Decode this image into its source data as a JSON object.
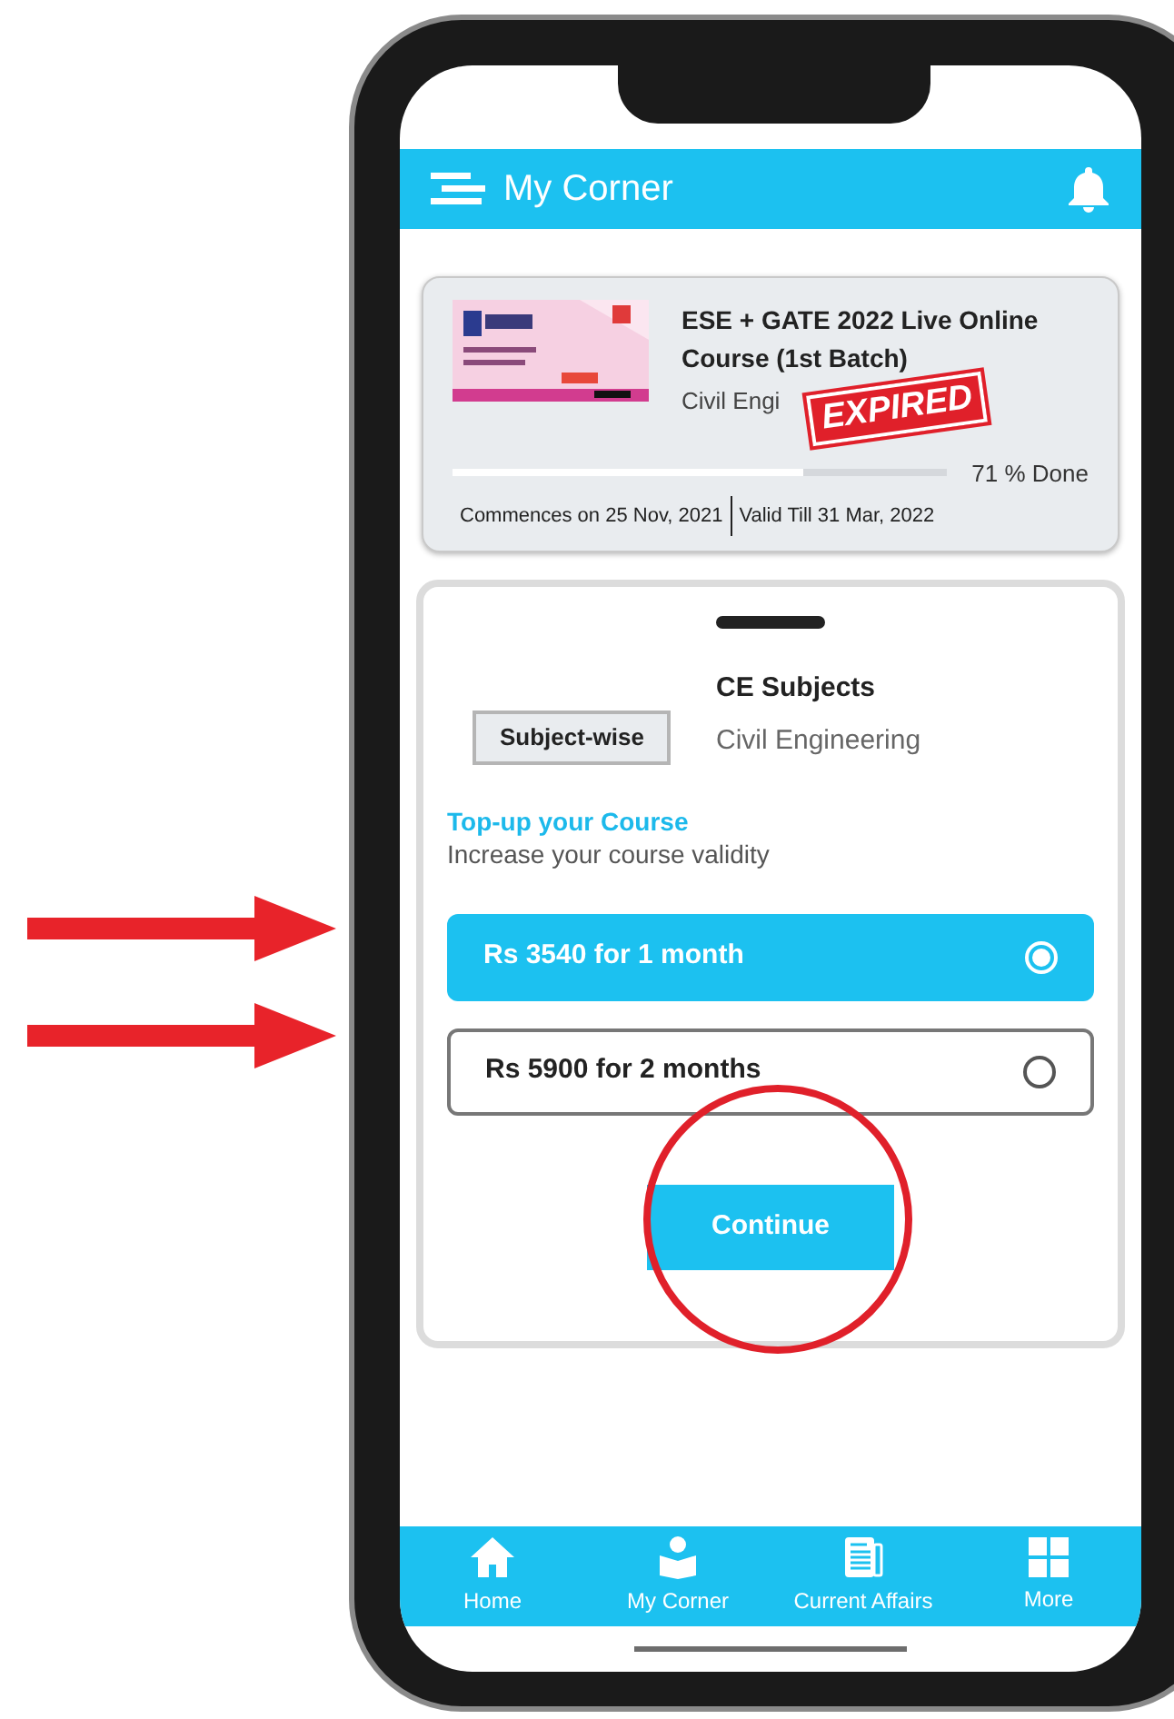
{
  "header": {
    "title": "My Corner"
  },
  "course": {
    "title": "ESE + GATE 2022 Live Online Course (1st Batch)",
    "subtitle": "Civil Engi",
    "stamp": "EXPIRED",
    "level": 0.71,
    "done": "71 % Done",
    "commences": "Commences on 25 Nov, 2021",
    "valid": "Valid Till 31 Mar, 2022"
  },
  "sheet": {
    "tag": "Subject-wise",
    "name": "CE Subjects",
    "branch": "Civil Engineering",
    "topup_title": "Top-up your Course",
    "topup_subtitle": "Increase your course validity",
    "options": [
      {
        "label": "Rs 3540 for 1 month",
        "selected": true
      },
      {
        "label": "Rs 5900 for 2 months",
        "selected": false
      }
    ],
    "button": "Continue"
  },
  "nav": [
    {
      "kind": "home",
      "label": "Home"
    },
    {
      "kind": "reader",
      "label": "My Corner"
    },
    {
      "kind": "news",
      "label": "Current Affairs"
    },
    {
      "kind": "grid",
      "label": "More"
    }
  ]
}
